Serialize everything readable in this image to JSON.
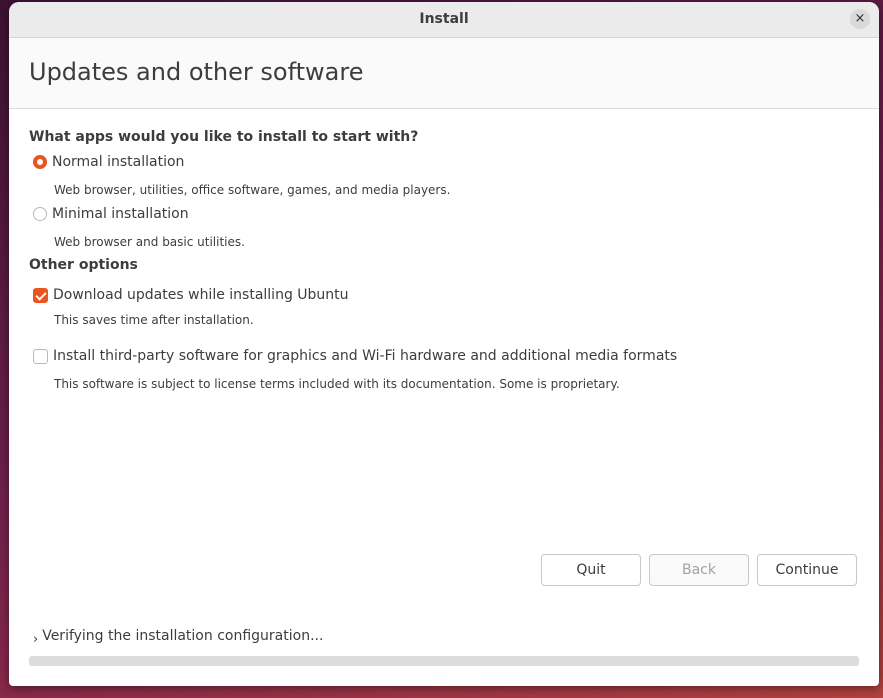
{
  "window": {
    "title": "Install",
    "close_glyph": "×"
  },
  "header": {
    "title": "Updates and other software"
  },
  "install_type": {
    "heading": "What apps would you like to install to start with?",
    "options": [
      {
        "label": "Normal installation",
        "description": "Web browser, utilities, office software, games, and media players.",
        "selected": true
      },
      {
        "label": "Minimal installation",
        "description": "Web browser and basic utilities.",
        "selected": false
      }
    ]
  },
  "other_options": {
    "heading": "Other options",
    "items": [
      {
        "label": "Download updates while installing Ubuntu",
        "description": "This saves time after installation.",
        "checked": true
      },
      {
        "label": "Install third-party software for graphics and Wi-Fi hardware and additional media formats",
        "description": "This software is subject to license terms included with its documentation. Some is proprietary.",
        "checked": false
      }
    ]
  },
  "buttons": {
    "quit": "Quit",
    "back": "Back",
    "continue": "Continue"
  },
  "status": {
    "chevron_glyph": "›",
    "text": "Verifying the installation configuration..."
  },
  "progress": {
    "value": 0
  },
  "colors": {
    "accent": "#e95420"
  }
}
